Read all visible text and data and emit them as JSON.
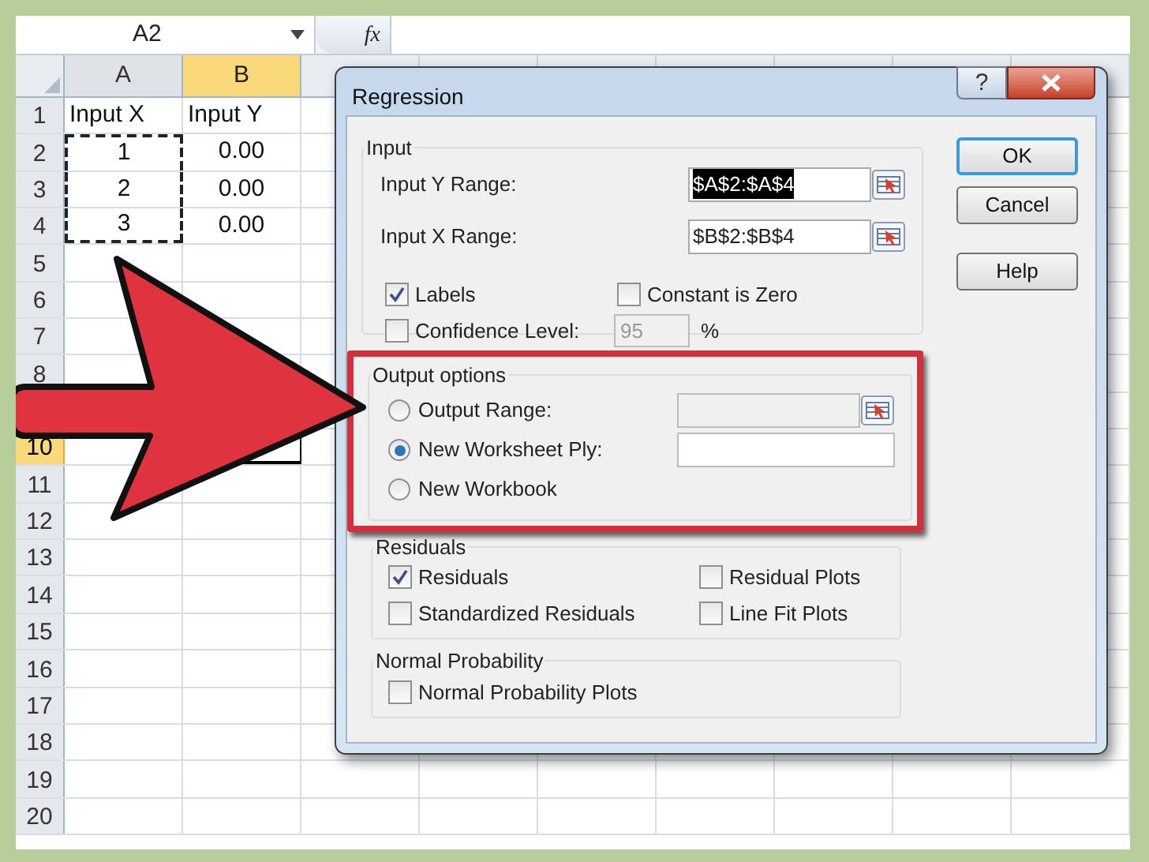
{
  "formula_bar": {
    "name_box": "A2",
    "function_label": "fx"
  },
  "sheet": {
    "columns": [
      {
        "label": "A",
        "selected": false
      },
      {
        "label": "B",
        "selected": true
      }
    ],
    "rows": [
      {
        "label": "1",
        "selected": false,
        "cells": [
          {
            "text": "Input X",
            "kind": "text",
            "marquee": false
          },
          {
            "text": "Input Y",
            "kind": "text",
            "marquee": false
          }
        ]
      },
      {
        "label": "2",
        "selected": false,
        "cells": [
          {
            "text": "1",
            "kind": "number",
            "marquee": true
          },
          {
            "text": "0.00",
            "kind": "number",
            "marquee": false
          }
        ]
      },
      {
        "label": "3",
        "selected": false,
        "cells": [
          {
            "text": "2",
            "kind": "number",
            "marquee": true
          },
          {
            "text": "0.00",
            "kind": "number",
            "marquee": false
          }
        ]
      },
      {
        "label": "4",
        "selected": false,
        "cells": [
          {
            "text": "3",
            "kind": "number",
            "marquee": true
          },
          {
            "text": "0.00",
            "kind": "number",
            "marquee": false
          }
        ]
      },
      {
        "label": "5",
        "selected": false
      },
      {
        "label": "6",
        "selected": false
      },
      {
        "label": "7",
        "selected": false
      },
      {
        "label": "8",
        "selected": false
      },
      {},
      {
        "label": "10",
        "selected": true
      },
      {
        "label": "11",
        "selected": false
      },
      {
        "label": "12",
        "selected": false
      },
      {
        "label": "13",
        "selected": false
      },
      {
        "label": "14",
        "selected": false
      },
      {
        "label": "15",
        "selected": false
      },
      {
        "label": "16",
        "selected": false
      },
      {
        "label": "17",
        "selected": false
      },
      {
        "label": "18",
        "selected": false
      },
      {
        "label": "19",
        "selected": false
      },
      {
        "label": "20",
        "selected": false
      }
    ]
  },
  "dialog": {
    "title": "Regression",
    "help_glyph": "?",
    "buttons": [
      {
        "label": "OK",
        "default": true
      },
      {
        "label": "Cancel",
        "default": false
      },
      {
        "label": "Help",
        "default": false
      }
    ],
    "input_group": {
      "title": "Input",
      "ranges": [
        {
          "label": "Input Y Range:",
          "value": "$A$2:$A$4",
          "highlighted": true
        },
        {
          "label": "Input X Range:",
          "value": "$B$2:$B$4",
          "highlighted": false
        }
      ],
      "options": [
        {
          "label": "Labels",
          "checked": true
        },
        {
          "label": "Constant is Zero",
          "checked": false
        }
      ],
      "confidence": {
        "label": "Confidence Level:",
        "checked": false,
        "value": "95",
        "disabled": true,
        "unit": "%"
      }
    },
    "output_group": {
      "title": "Output options",
      "emphasized": true,
      "options": [
        {
          "label": "Output Range:",
          "selected": false,
          "field": {
            "disabled": true,
            "picker": true
          }
        },
        {
          "label": "New Worksheet Ply:",
          "selected": true,
          "field": {
            "disabled": false,
            "picker": false
          }
        },
        {
          "label": "New Workbook",
          "selected": false
        }
      ]
    },
    "residuals_group": {
      "title": "Residuals",
      "options": [
        {
          "label": "Residuals",
          "checked": true
        },
        {
          "label": "Residual Plots",
          "checked": false
        },
        {
          "label": "Standardized Residuals",
          "checked": false
        },
        {
          "label": "Line Fit Plots",
          "checked": false
        }
      ]
    },
    "normal_group": {
      "title": "Normal Probability",
      "options": [
        {
          "label": "Normal Probability Plots",
          "checked": false
        }
      ]
    }
  }
}
